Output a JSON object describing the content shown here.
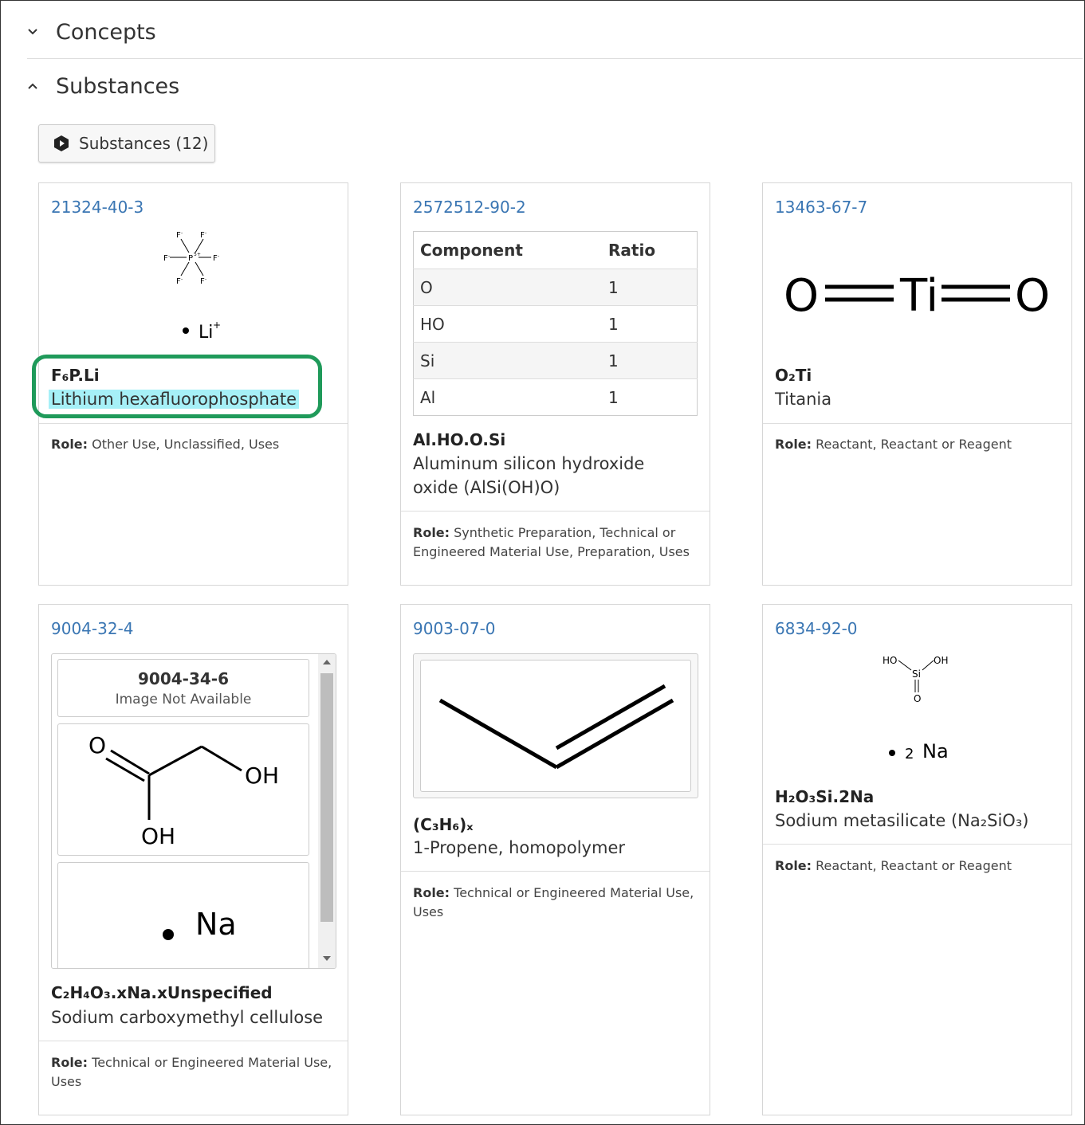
{
  "sections": [
    {
      "title": "Concepts",
      "expanded": false
    },
    {
      "title": "Substances",
      "expanded": true
    }
  ],
  "substances_button": {
    "label": "Substances (12)",
    "icon": "cas-hexagon-icon"
  },
  "cards": [
    {
      "cas": "21324-40-3",
      "formula": "F₆P.Li",
      "name": "Lithium hexafluorophosphate",
      "role_label": "Role:",
      "role": "Other Use, Unclassified, Uses",
      "structure": {
        "center": "P5+",
        "ligands": [
          "F-",
          "F-",
          "F-",
          "F-",
          "F-",
          "F-"
        ],
        "counter_ion": "Li+"
      }
    },
    {
      "cas": "2572512-90-2",
      "formula": "Al.HO.O.Si",
      "name": "Aluminum silicon hydroxide oxide (AlSi(OH)O)",
      "role_label": "Role:",
      "role": "Synthetic Preparation, Technical or Engineered Material Use, Preparation, Uses",
      "table": {
        "headers": [
          "Component",
          "Ratio"
        ],
        "rows": [
          [
            "O",
            "1"
          ],
          [
            "HO",
            "1"
          ],
          [
            "Si",
            "1"
          ],
          [
            "Al",
            "1"
          ]
        ]
      }
    },
    {
      "cas": "13463-67-7",
      "formula": "O₂Ti",
      "name": "Titania",
      "role_label": "Role:",
      "role": "Reactant, Reactant or Reagent",
      "structure": {
        "atoms": [
          "O",
          "Ti",
          "O"
        ]
      }
    },
    {
      "cas": "9004-32-4",
      "formula": "C₂H₄O₃.xNa.xUnspecified",
      "name": "Sodium carboxymethyl cellulose",
      "role_label": "Role:",
      "role": "Technical or Engineered Material Use, Uses",
      "components": [
        {
          "cas": "9004-34-6",
          "note": "Image Not Available"
        }
      ],
      "structure": {
        "labels": [
          "O",
          "OH",
          "OH",
          "Na"
        ]
      }
    },
    {
      "cas": "9003-07-0",
      "formula": "(C₃H₆)ₓ",
      "name": "1-Propene, homopolymer",
      "role_label": "Role:",
      "role": "Technical or Engineered Material Use, Uses"
    },
    {
      "cas": "6834-92-0",
      "formula": "H₂O₃Si.2Na",
      "name": "Sodium metasilicate (Na₂SiO₃)",
      "role_label": "Role:",
      "role": "Reactant, Reactant or Reagent",
      "structure": {
        "labels": [
          "HO",
          "OH",
          "Si",
          "O"
        ],
        "counter_ion": "2 Na"
      }
    }
  ],
  "colors": {
    "link": "#3a76b3",
    "highlight": "#a6f0f7",
    "ring": "#1f9a5a"
  }
}
